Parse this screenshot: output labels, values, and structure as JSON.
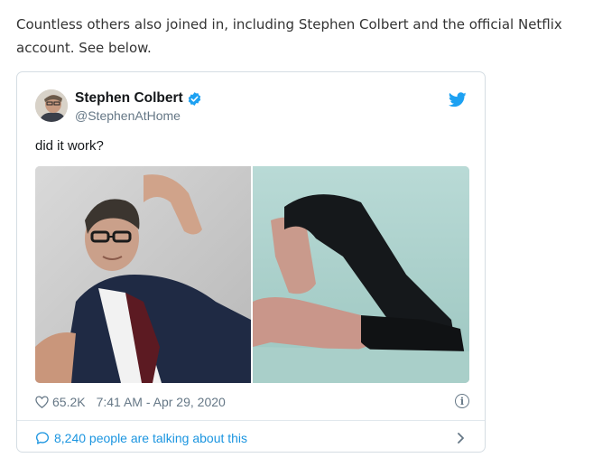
{
  "article": {
    "intro_text": "Countless others also joined in, including Stephen Colbert and the official Netflix account. See below."
  },
  "tweet": {
    "display_name": "Stephen Colbert",
    "handle": "@StephenAtHome",
    "text": "did it work?",
    "likes": "65.2K",
    "timestamp": "7:41 AM - Apr 29, 2020",
    "talking_about": "8,240 people are talking about this",
    "icons": {
      "verified": "verified-badge-icon",
      "brand": "twitter-bird-icon",
      "like": "heart-icon",
      "info": "info-icon",
      "reply": "speech-bubble-icon",
      "more": "chevron-right-icon"
    }
  },
  "colors": {
    "link_blue": "#1b95e0",
    "twitter_blue": "#1da1f2",
    "secondary_text": "#657786",
    "border": "#d5dde3"
  }
}
